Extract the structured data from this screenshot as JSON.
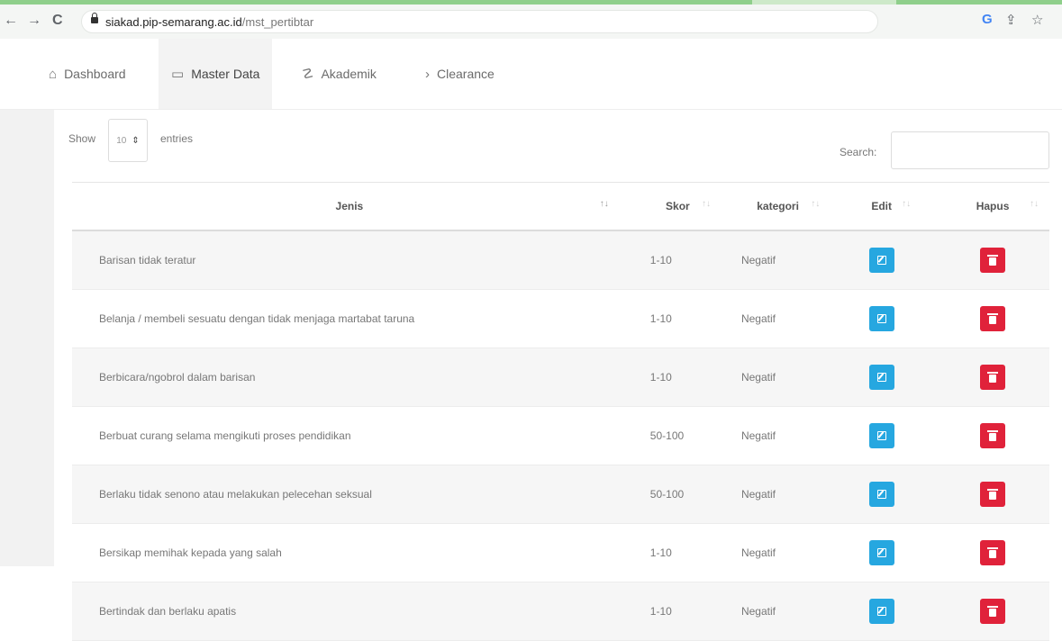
{
  "browser": {
    "url_domain": "siakad.pip-semarang.ac.id",
    "url_path": "/mst_pertibtar",
    "back_glyph": "←",
    "forward_glyph": "→",
    "reload_glyph": "C",
    "google_glyph": "G",
    "share_glyph": "⇪",
    "star_glyph": "☆"
  },
  "nav": {
    "items": [
      {
        "label": "Dashboard",
        "icon": "home-icon",
        "glyph": "⌂"
      },
      {
        "label": "Master Data",
        "icon": "book-icon",
        "glyph": "▭"
      },
      {
        "label": "Akademik",
        "icon": "graduation-cap-icon",
        "glyph": "☡"
      },
      {
        "label": "Clearance",
        "icon": "chevron-right-icon",
        "glyph": "›"
      }
    ],
    "active": "Master Data"
  },
  "table_controls": {
    "show_label": "Show",
    "page_length": "10",
    "entries_label": "entries",
    "search_label": "Search:",
    "search_value": ""
  },
  "table": {
    "columns": [
      "Jenis",
      "Skor",
      "kategori",
      "Edit",
      "Hapus"
    ],
    "sort_glyphs": [
      "↑↓",
      "↑↓",
      "↑↓",
      "↑↓",
      "↑↓"
    ],
    "rows": [
      {
        "jenis": "Barisan tidak teratur",
        "skor": "1-10",
        "kategori": "Negatif"
      },
      {
        "jenis": "Belanja / membeli sesuatu dengan tidak menjaga martabat taruna",
        "skor": "1-10",
        "kategori": "Negatif"
      },
      {
        "jenis": "Berbicara/ngobrol dalam barisan",
        "skor": "1-10",
        "kategori": "Negatif"
      },
      {
        "jenis": "Berbuat curang selama mengikuti proses pendidikan",
        "skor": "50-100",
        "kategori": "Negatif"
      },
      {
        "jenis": "Berlaku tidak senono atau melakukan pelecehan seksual",
        "skor": "50-100",
        "kategori": "Negatif"
      },
      {
        "jenis": "Bersikap memihak kepada yang salah",
        "skor": "1-10",
        "kategori": "Negatif"
      },
      {
        "jenis": "Bertindak dan berlaku apatis",
        "skor": "1-10",
        "kategori": "Negatif"
      }
    ]
  },
  "colors": {
    "edit_button": "#26a7e0",
    "delete_button": "#e0223a",
    "top_accent": "#8fcf8b"
  }
}
